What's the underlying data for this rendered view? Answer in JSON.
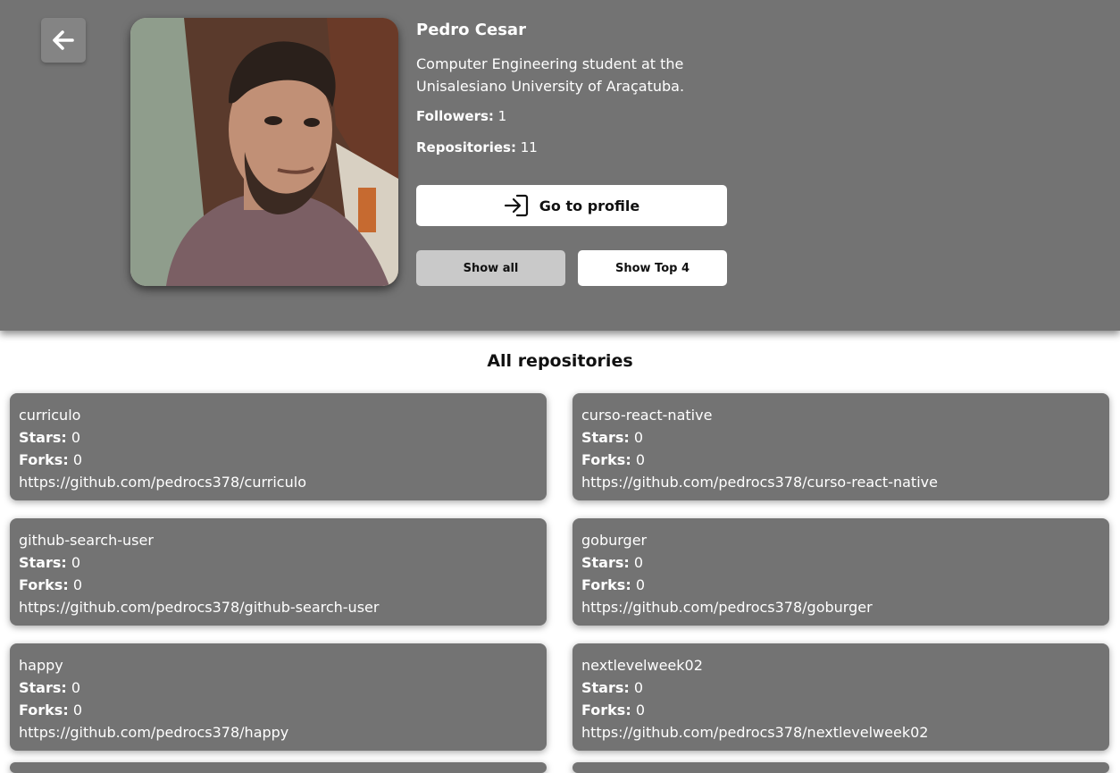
{
  "profile": {
    "name": "Pedro Cesar",
    "bio": "Computer Engineering student at the Unisalesiano University of Araçatuba.",
    "followers_label": "Followers:",
    "followers": "1",
    "repos_label": "Repositories:",
    "repos": "11"
  },
  "actions": {
    "go_profile": "Go to profile",
    "show_all": "Show all",
    "show_top": "Show Top 4"
  },
  "section_title": "All repositories",
  "labels": {
    "stars": "Stars:",
    "forks": "Forks:"
  },
  "repos": [
    {
      "name": "curriculo",
      "stars": "0",
      "forks": "0",
      "url": "https://github.com/pedrocs378/curriculo"
    },
    {
      "name": "curso-react-native",
      "stars": "0",
      "forks": "0",
      "url": "https://github.com/pedrocs378/curso-react-native"
    },
    {
      "name": "github-search-user",
      "stars": "0",
      "forks": "0",
      "url": "https://github.com/pedrocs378/github-search-user"
    },
    {
      "name": "goburger",
      "stars": "0",
      "forks": "0",
      "url": "https://github.com/pedrocs378/goburger"
    },
    {
      "name": "happy",
      "stars": "0",
      "forks": "0",
      "url": "https://github.com/pedrocs378/happy"
    },
    {
      "name": "nextlevelweek02",
      "stars": "0",
      "forks": "0",
      "url": "https://github.com/pedrocs378/nextlevelweek02"
    }
  ],
  "colors": {
    "header_bg": "#737373",
    "card_bg": "#737373",
    "show_all_bg": "#c9c9c9",
    "text_light": "#ffffff"
  },
  "icons": {
    "back": "arrow-left-icon",
    "login": "login-icon"
  }
}
